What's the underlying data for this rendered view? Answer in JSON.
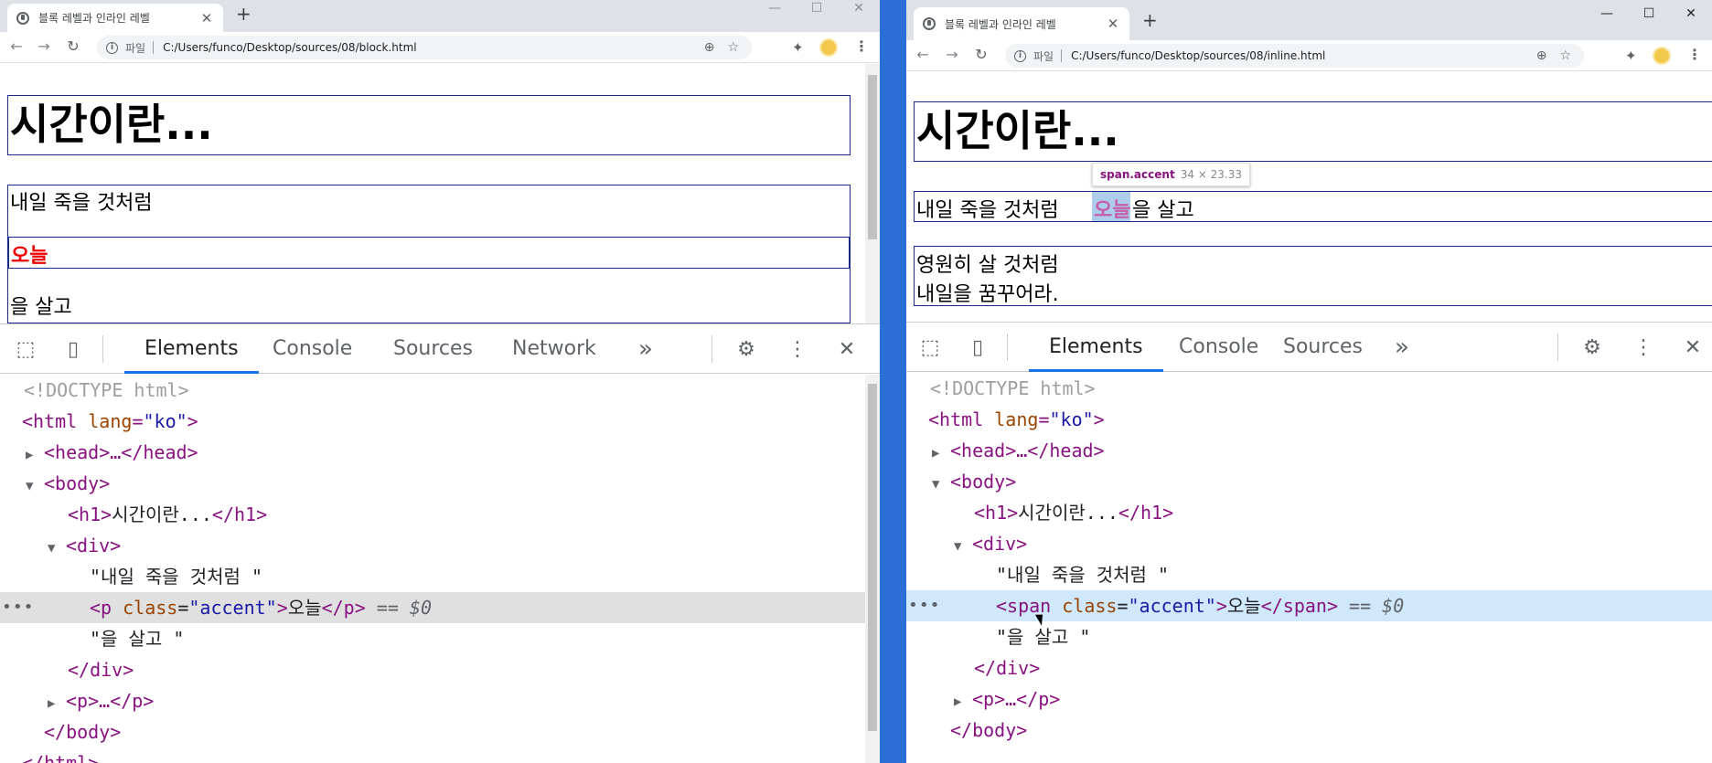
{
  "left_window": {
    "tab_title": "블록 레벨과 인라인 레벨",
    "new_tab": "+",
    "window_controls": [
      "—",
      "☐",
      "✕"
    ],
    "nav": {
      "back": "←",
      "forward": "→",
      "reload": "↻"
    },
    "address": {
      "scheme": "파일",
      "url": "C:/Users/funco/Desktop/sources/08/block.html"
    },
    "page": {
      "h1": "시간이란...",
      "div_text1": "내일 죽을 것처럼",
      "p_accent": "오늘",
      "div_text2": "을 살고"
    },
    "devtools": {
      "tabs": [
        "Elements",
        "Console",
        "Sources",
        "Network"
      ],
      "more": "»",
      "close": "✕",
      "dom": {
        "doctype": "<!DOCTYPE html>",
        "html_open": "<html lang=\"ko\">",
        "html_tag": "html",
        "lang_attr": "lang",
        "lang_val": "\"ko\"",
        "head": "<head>…</head>",
        "body_open": "<body>",
        "h1_open": "<h1>",
        "h1_text": "시간이란...",
        "h1_close": "</h1>",
        "div_open": "<div>",
        "text1": "\"내일 죽을 것처럼 \"",
        "p_open_tag": "<p",
        "class_attr": " class",
        "class_val": "\"accent\"",
        "p_text": "오늘",
        "p_close": "</p>",
        "eq": " == $0",
        "text2": "\"을 살고 \"",
        "div_close": "</div>",
        "p_collapsed": "<p>…</p>",
        "body_close": "</body>",
        "html_close": "</html>"
      }
    }
  },
  "right_window": {
    "tab_title": "블록 레벨과 인라인 레벨",
    "new_tab": "+",
    "window_controls": [
      "—",
      "☐",
      "✕"
    ],
    "nav": {
      "back": "←",
      "forward": "→",
      "reload": "↻"
    },
    "address": {
      "scheme": "파일",
      "url": "C:/Users/funco/Desktop/sources/08/inline.html"
    },
    "page": {
      "h1": "시간이란...",
      "div_text1": "내일 죽을 것처럼",
      "span_accent": "오늘",
      "div_text2": "을 살고",
      "p_line1": "영원히 살 것처럼",
      "p_line2": "내일을 꿈꾸어라."
    },
    "tooltip": {
      "name": "span.accent",
      "size": "34 × 23.33"
    },
    "devtools": {
      "tabs": [
        "Elements",
        "Console",
        "Sources"
      ],
      "more": "»",
      "close": "✕",
      "dom": {
        "doctype": "<!DOCTYPE html>",
        "html_tag": "html",
        "lang_attr": "lang",
        "lang_val": "\"ko\"",
        "head": "<head>…</head>",
        "body_open": "<body>",
        "h1_open": "<h1>",
        "h1_text": "시간이란...",
        "h1_close": "</h1>",
        "div_open": "<div>",
        "text1": "\"내일 죽을 것처럼 \"",
        "span_open_tag": "<span",
        "class_attr": " class",
        "class_val": "\"accent\"",
        "span_text": "오늘",
        "span_close": "</span>",
        "eq": " == $0",
        "text2": "\"을 살고 \"",
        "div_close": "</div>",
        "p_collapsed": "<p>…</p>",
        "body_close": "</body>"
      }
    }
  }
}
